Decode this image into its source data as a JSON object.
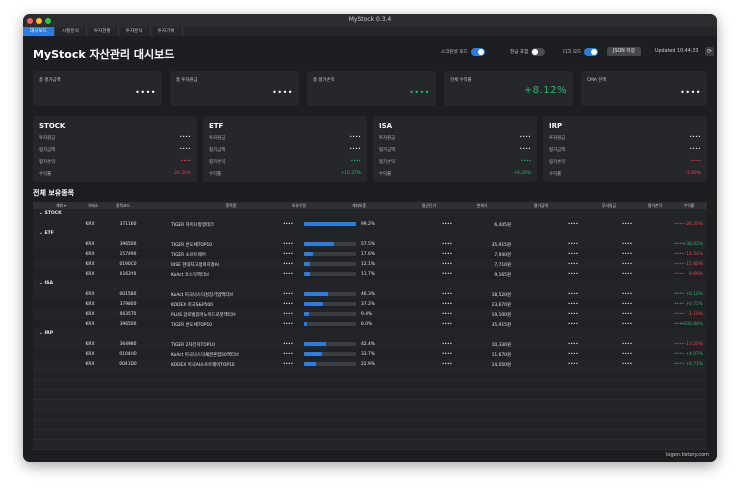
{
  "window": {
    "title": "MyStock 0.3.4"
  },
  "menu": [
    "대시보드",
    "시황분석",
    "투자현황",
    "투자분석",
    "투자기록"
  ],
  "header": {
    "title": "MyStock 자산관리 대시보드",
    "toggles": [
      {
        "label": "스크린샷 모드",
        "on": true
      },
      {
        "label": "현금 포함",
        "on": false
      },
      {
        "label": "다크 모드",
        "on": true
      }
    ],
    "json_button": "JSON 저장",
    "updated": "Updated 10:44:33"
  },
  "kpis": [
    {
      "label": "총 평가금액",
      "value": "••••",
      "style": ""
    },
    {
      "label": "총 투자원금",
      "value": "••••",
      "style": ""
    },
    {
      "label": "총 평가손익",
      "value": "••••",
      "style": "green"
    },
    {
      "label": "전체 수익률",
      "value": "+8.12%",
      "style": "green big"
    },
    {
      "label": "CMA 잔액",
      "value": "••••",
      "style": ""
    }
  ],
  "categories": [
    {
      "name": "STOCK",
      "lines": [
        {
          "k": "투자원금",
          "v": "••••",
          "s": "mask"
        },
        {
          "k": "평가금액",
          "v": "••••",
          "s": "mask"
        },
        {
          "k": "평가손익",
          "v": "••••",
          "s": "maskred"
        },
        {
          "k": "수익률",
          "v": "-26.30%",
          "s": "red"
        }
      ]
    },
    {
      "name": "ETF",
      "lines": [
        {
          "k": "투자원금",
          "v": "••••",
          "s": "mask"
        },
        {
          "k": "평가금액",
          "v": "••••",
          "s": "mask"
        },
        {
          "k": "평가손익",
          "v": "••••",
          "s": "maskgreen"
        },
        {
          "k": "수익률",
          "v": "+10.37%",
          "s": "green"
        }
      ]
    },
    {
      "name": "ISA",
      "lines": [
        {
          "k": "투자원금",
          "v": "••••",
          "s": "mask"
        },
        {
          "k": "평가금액",
          "v": "••••",
          "s": "mask"
        },
        {
          "k": "평가손익",
          "v": "••••",
          "s": "maskgreen"
        },
        {
          "k": "수익률",
          "v": "+6.28%",
          "s": "green"
        }
      ]
    },
    {
      "name": "IRP",
      "lines": [
        {
          "k": "투자원금",
          "v": "••••",
          "s": "mask"
        },
        {
          "k": "평가금액",
          "v": "••••",
          "s": "mask"
        },
        {
          "k": "평가손익",
          "v": "••••",
          "s": "maskred"
        },
        {
          "k": "수익률",
          "v": "-3.89%",
          "s": "red"
        }
      ]
    }
  ],
  "holdings_title": "전체 보유종목",
  "table_headers": [
    "계좌",
    "거래소",
    "종목코드",
    "종목명",
    "보유수량",
    "계좌비중",
    "평균단가",
    "현재가",
    "평가금액",
    "투자원금",
    "평가손익",
    "수익률"
  ],
  "groups": [
    {
      "name": "STOCK",
      "rows": [
        {
          "ex": "KRX",
          "code": "371160",
          "name": "TIGER 차이나항셍테크",
          "qty": "••••",
          "weight": 99.2,
          "weight_txt": "99.2%",
          "avg": "••••",
          "price": "6,445원",
          "eval": "••••",
          "cost": "••••",
          "pl": "••••",
          "pl_s": "red",
          "ret": "-26.30%",
          "ret_s": "red"
        }
      ]
    },
    {
      "name": "ETF",
      "rows": [
        {
          "ex": "KRX",
          "code": "396500",
          "name": "TIGER 반도체TOP10",
          "qty": "••••",
          "weight": 57.5,
          "weight_txt": "57.5%",
          "avg": "••••",
          "price": "35,915원",
          "eval": "••••",
          "cost": "••••",
          "pl": "••••",
          "pl_s": "green",
          "ret": "+38.02%",
          "ret_s": "green"
        },
        {
          "ex": "KRX",
          "code": "157490",
          "name": "TIGER 소프트웨어",
          "qty": "••••",
          "weight": 17.6,
          "weight_txt": "17.6%",
          "avg": "••••",
          "price": "7,940원",
          "eval": "••••",
          "cost": "••••",
          "pl": "••••",
          "pl_s": "red",
          "ret": "-14.54%",
          "ret_s": "red"
        },
        {
          "ex": "KRX",
          "code": "0190C0",
          "name": "RISE 현대차고정피지컬AI",
          "qty": "••••",
          "weight": 12.1,
          "weight_txt": "12.1%",
          "avg": "••••",
          "price": "7,710원",
          "eval": "••••",
          "cost": "••••",
          "pl": "••••",
          "pl_s": "red",
          "ret": "-15.80%",
          "ret_s": "red"
        },
        {
          "ex": "KRX",
          "code": "0163Y0",
          "name": "KoAct 코스닥액티브",
          "qty": "••••",
          "weight": 11.7,
          "weight_txt": "11.7%",
          "avg": "••••",
          "price": "9,165원",
          "eval": "••••",
          "cost": "••••",
          "pl": "••••",
          "pl_s": "red",
          "ret": "-9.66%",
          "ret_s": "red"
        }
      ]
    },
    {
      "name": "ISA",
      "rows": [
        {
          "ex": "KRX",
          "code": "0015B0",
          "name": "KoAct 미국나스닥성장기업액티브",
          "qty": "••••",
          "weight": 46.3,
          "weight_txt": "46.3%",
          "avg": "••••",
          "price": "18,520원",
          "eval": "••••",
          "cost": "••••",
          "pl": "••••",
          "pl_s": "green",
          "ret": "+6.10%",
          "ret_s": "green"
        },
        {
          "ex": "KRX",
          "code": "379800",
          "name": "KODEX 미국S&P500",
          "qty": "••••",
          "weight": 37.2,
          "weight_txt": "37.2%",
          "avg": "••••",
          "price": "23,670원",
          "eval": "••••",
          "cost": "••••",
          "pl": "••••",
          "pl_s": "green",
          "ret": "+0.71%",
          "ret_s": "green"
        },
        {
          "ex": "KRX",
          "code": "0035T0",
          "name": "PLUS 글로벌휴머노이드로봇액티브",
          "qty": "••••",
          "weight": 9.4,
          "weight_txt": "9.4%",
          "avg": "••••",
          "price": "19,100원",
          "eval": "••••",
          "cost": "••••",
          "pl": "••••",
          "pl_s": "red",
          "ret": "-1.10%",
          "ret_s": "red"
        },
        {
          "ex": "KRX",
          "code": "396500",
          "name": "TIGER 반도체TOP10",
          "qty": "••••",
          "weight": 6.0,
          "weight_txt": "6.0%",
          "avg": "••••",
          "price": "35,915원",
          "eval": "••••",
          "cost": "••••",
          "pl": "••••",
          "pl_s": "green",
          "ret": "+100.84%",
          "ret_s": "green"
        }
      ]
    },
    {
      "name": "IRP",
      "rows": [
        {
          "ex": "KRX",
          "code": "364980",
          "name": "TIGER 2차전지TOP10",
          "qty": "••••",
          "weight": 42.4,
          "weight_txt": "42.4%",
          "avg": "••••",
          "price": "10,330원",
          "eval": "••••",
          "cost": "••••",
          "pl": "••••",
          "pl_s": "red",
          "ret": "-13.20%",
          "ret_s": "red"
        },
        {
          "ex": "KRX",
          "code": "0104H0",
          "name": "KoAct 미국나스닥채권혼합50액티브",
          "qty": "••••",
          "weight": 33.7,
          "weight_txt": "33.7%",
          "avg": "••••",
          "price": "11,670원",
          "eval": "••••",
          "cost": "••••",
          "pl": "••••",
          "pl_s": "green",
          "ret": "+4.07%",
          "ret_s": "green"
        },
        {
          "ex": "KRX",
          "code": "0041D0",
          "name": "KODEX 미국AI소프트웨어TOP10",
          "qty": "••••",
          "weight": 22.9,
          "weight_txt": "22.9%",
          "avg": "••••",
          "price": "14,050원",
          "eval": "••••",
          "cost": "••••",
          "pl": "••••",
          "pl_s": "green",
          "ret": "+6.71%",
          "ret_s": "green"
        }
      ]
    }
  ],
  "footer": "logon.tistory.com",
  "colors": {
    "accent": "#2a7de1",
    "gain": "#2bb673",
    "loss": "#e5484d",
    "background": "#1c1e22",
    "panel": "#25272b"
  }
}
